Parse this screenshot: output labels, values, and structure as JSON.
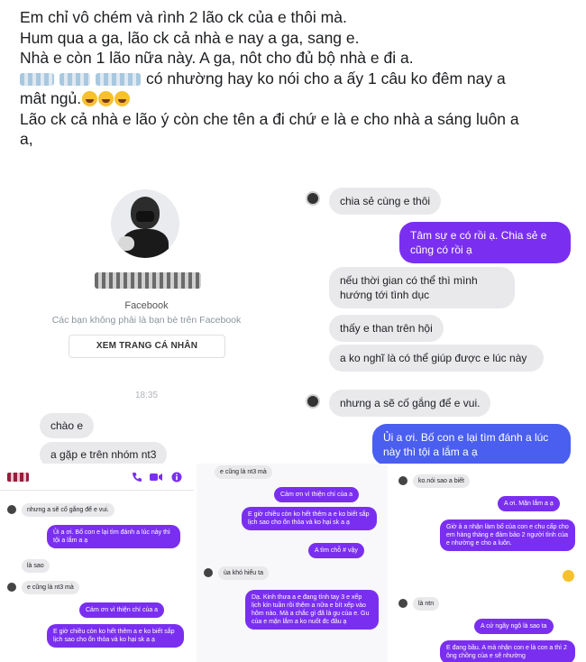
{
  "post": {
    "line1": "Em chỉ vô chém và rình 2 lão ck của e thôi mà.",
    "line2": "Hum qua a ga, lão ck cả nhà e nay a ga, sang e.",
    "line3": "Nhà e còn 1 lão nữa này. A ga, nôt cho đủ bộ nhà e đi a.",
    "line4_text": "có nhường hay ko nói cho a ấy 1 câu ko đêm nay a",
    "line5": "mât ngủ.",
    "line6": "Lão ck cả nhà e lão ý còn che tên a đi chứ e là e cho nhà a sáng luôn a",
    "line7": "a,"
  },
  "main_chat": {
    "profile": {
      "platform": "Facebook",
      "subtitle": "Các bạn không phải là bạn bè trên Facebook",
      "view_button": "XEM TRANG CÁ NHÂN",
      "time": "18:35"
    },
    "left_messages": [
      "chào e",
      "a gặp e trên nhóm nt3"
    ],
    "right_messages": [
      {
        "side": "received",
        "text": "chia sẻ cùng e thôi"
      },
      {
        "side": "sent",
        "text": "Tâm sự e có rồi ạ. Chia sẻ e cũng có rồi ạ"
      },
      {
        "side": "received",
        "text": "nếu thời gian có thể thì mình hướng tới tình dục"
      },
      {
        "side": "received",
        "text": "thấy e than trên hội"
      },
      {
        "side": "received",
        "text": "a ko nghĩ là có thể giúp được e lúc này"
      },
      {
        "side": "received",
        "text": "nhưng a sẽ cố gắng để e vui."
      },
      {
        "side": "sent",
        "text": "Ủi a ơi. Bố con e lại tìm đánh a lúc này thì tội a lắm a ạ"
      }
    ]
  },
  "thumb1": {
    "messages": [
      {
        "side": "received",
        "text": "nhưng a sẽ cố gắng để e vui."
      },
      {
        "side": "sent",
        "text": "Ủi a ơi. Bố con e lại tìm đánh a lúc này thì tội a lắm a ạ"
      },
      {
        "side": "received",
        "text": "là sao"
      },
      {
        "side": "received",
        "text": "e cũng là nt3 mà"
      },
      {
        "side": "sent",
        "text": "Cảm ơn vì thiện chí của a"
      },
      {
        "side": "sent",
        "text": "E giờ chiều còn ko hết thêm a e ko biết sắp lịch sao cho ổn thỏa và ko hại sk a ạ"
      }
    ]
  },
  "thumb2": {
    "messages": [
      {
        "side": "received",
        "text": "e cũng là nt3 mà"
      },
      {
        "side": "sent",
        "text": "Cảm ơn vì thiện chí của a"
      },
      {
        "side": "sent",
        "text": "E giờ chiều còn ko hết thêm a e ko biết sắp lịch sao cho ổn thỏa và ko hại sk a ạ"
      },
      {
        "side": "sent",
        "text": "A tìm chỗ # vậy"
      },
      {
        "side": "received",
        "text": "ùa khó hiểu ta"
      },
      {
        "side": "sent",
        "text": "Dạ. Kinh thưa a e đang tính tay 3 e xếp lịch kín tuần rồi thêm a nữa e bít xếp vào hôm nào. Mà a chắc gì đã là gu của e. Gu của e mặn lắm a ko nuốt đc đâu ạ"
      }
    ]
  },
  "thumb3": {
    "messages": [
      {
        "side": "received",
        "text": "ko.nói sao a biết"
      },
      {
        "side": "sent",
        "text": "A ơi. Mặn lắm a ạ"
      },
      {
        "side": "sent",
        "text": "Giờ ả a nhận làm bố của con e chu cấp cho em hàng tháng e đảm bảo 2 người tình của e nhường e cho a luôn."
      },
      {
        "side": "received",
        "text": "là ntn"
      },
      {
        "side": "sent",
        "text": "A cứ ngãy ngô là sao ta"
      },
      {
        "side": "sent",
        "text": "E đang bầu. A mà nhận con e là con a thì 2 ông chồng của e sẽ nhường"
      }
    ]
  },
  "colors": {
    "messenger_purple": "#7a2ff0",
    "messenger_blue": "#4a5ef0",
    "bubble_grey": "#e9e9ec"
  }
}
